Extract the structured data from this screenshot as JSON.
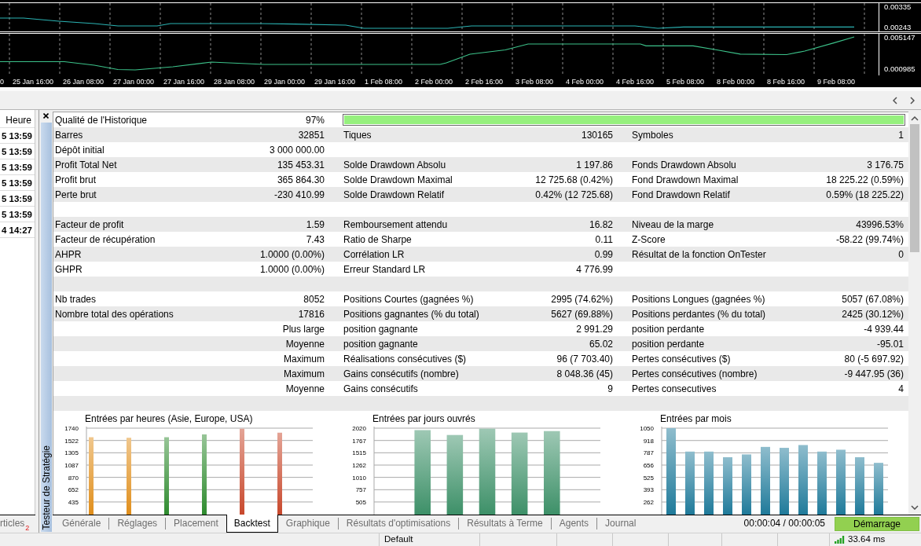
{
  "price_chart": {
    "panels": [
      {
        "axis_labels": [
          "0.00335",
          "0.00243"
        ]
      },
      {
        "axis_labels": [
          "0.005147",
          "0.000985"
        ]
      }
    ],
    "time_labels": [
      "0",
      "25 Jan 16:00",
      "26 Jan 08:00",
      "27 Jan 00:00",
      "27 Jan 16:00",
      "28 Jan 08:00",
      "29 Jan 00:00",
      "29 Jan 16:00",
      "1 Feb 08:00",
      "2 Feb 00:00",
      "2 Feb 16:00",
      "3 Feb 08:00",
      "4 Feb 00:00",
      "4 Feb 16:00",
      "5 Feb 08:00",
      "8 Feb 00:00",
      "8 Feb 16:00",
      "9 Feb 08:00"
    ]
  },
  "left_panel": {
    "column": "Heure",
    "rows": [
      "5 13:59",
      "5 13:59",
      "5 13:59",
      "5 13:59",
      "5 13:59",
      "5 13:59",
      "4 14:27"
    ],
    "tab": {
      "label": "rticles",
      "badge": "2"
    }
  },
  "tester": {
    "title": "Testeur de Stratégie",
    "report": {
      "rows": [
        {
          "kind": "quality",
          "label": "Qualité de l'Historique",
          "value": "97%",
          "level": 1
        },
        {
          "kind": "stats",
          "cells": [
            {
              "label": "Barres",
              "value": "32851"
            },
            {
              "label": "Tiques",
              "value": "130165"
            },
            {
              "label": "Symboles",
              "value": "1"
            }
          ]
        },
        {
          "kind": "stats",
          "cells": [
            {
              "label": "Dépôt initial",
              "value": "3 000 000.00"
            }
          ]
        },
        {
          "kind": "stats",
          "cells": [
            {
              "label": "Profit Total Net",
              "value": "135 453.31"
            },
            {
              "label": "Solde Drawdown Absolu",
              "value": "1 197.86"
            },
            {
              "label": "Fonds Drawdown Absolu",
              "value": "3 176.75"
            }
          ]
        },
        {
          "kind": "stats",
          "cells": [
            {
              "label": "Profit brut",
              "value": "365 864.30"
            },
            {
              "label": "Solde Drawdown Maximal",
              "value": "12 725.68 (0.42%)"
            },
            {
              "label": "Fond Drawdown Maximal",
              "value": "18 225.22 (0.59%)"
            }
          ]
        },
        {
          "kind": "stats",
          "cells": [
            {
              "label": "Perte brut",
              "value": "-230 410.99"
            },
            {
              "label": "Solde Drawdown Relatif",
              "value": "0.42% (12 725.68)"
            },
            {
              "label": "Fond Drawdown Relatif",
              "value": "0.59% (18 225.22)"
            }
          ]
        },
        {
          "kind": "spacer"
        },
        {
          "kind": "stats",
          "cells": [
            {
              "label": "Facteur de profit",
              "value": "1.59"
            },
            {
              "label": "Remboursement attendu",
              "value": "16.82"
            },
            {
              "label": "Niveau de la marge",
              "value": "43996.53%"
            }
          ]
        },
        {
          "kind": "stats",
          "cells": [
            {
              "label": "Facteur de récupération",
              "value": "7.43"
            },
            {
              "label": "Ratio de Sharpe",
              "value": "0.11"
            },
            {
              "label": "Z-Score",
              "value": "-58.22 (99.74%)"
            }
          ]
        },
        {
          "kind": "stats",
          "cells": [
            {
              "label": "AHPR",
              "value": "1.0000 (0.00%)"
            },
            {
              "label": "Corrélation LR",
              "value": "0.99"
            },
            {
              "label": "Résultat de la fonction OnTester",
              "value": "0"
            }
          ]
        },
        {
          "kind": "stats",
          "cells": [
            {
              "label": "GHPR",
              "value": "1.0000 (0.00%)"
            },
            {
              "label": "Erreur Standard LR",
              "value": "4 776.99"
            }
          ]
        },
        {
          "kind": "spacer"
        },
        {
          "kind": "stats",
          "cells": [
            {
              "label": "Nb trades",
              "value": "8052"
            },
            {
              "label": "Positions Courtes (gagnées %)",
              "value": "2995 (74.62%)"
            },
            {
              "label": "Positions Longues (gagnées %)",
              "value": "5057 (67.08%)"
            }
          ]
        },
        {
          "kind": "stats",
          "cells": [
            {
              "label": "Nombre total des opérations",
              "value": "17816"
            },
            {
              "label": "Positions gagnantes (% du total)",
              "value": "5627 (69.88%)"
            },
            {
              "label": "Positions perdantes (% du total)",
              "value": "2425 (30.12%)"
            }
          ]
        },
        {
          "kind": "stats",
          "cells": [
            {
              "value": "Plus large"
            },
            {
              "label": "position gagnante",
              "value": "2 991.29"
            },
            {
              "label": "position perdante",
              "value": "-4 939.44"
            }
          ]
        },
        {
          "kind": "stats",
          "cells": [
            {
              "value": "Moyenne"
            },
            {
              "label": "position gagnante",
              "value": "65.02"
            },
            {
              "label": "position perdante",
              "value": "-95.01"
            }
          ]
        },
        {
          "kind": "stats",
          "cells": [
            {
              "value": "Maximum"
            },
            {
              "label": "Réalisations consécutives ($)",
              "value": "96 (7 703.40)"
            },
            {
              "label": "Pertes consécutives ($)",
              "value": "80 (-5 697.92)"
            }
          ]
        },
        {
          "kind": "stats",
          "cells": [
            {
              "value": "Maximum"
            },
            {
              "label": "Gains consécutifs (nombre)",
              "value": "8 048.36 (45)"
            },
            {
              "label": "Pertes consécutives (nombre)",
              "value": "-9 447.95 (36)"
            }
          ]
        },
        {
          "kind": "stats",
          "cells": [
            {
              "value": "Moyenne"
            },
            {
              "label": "Gains consécutifs",
              "value": "9"
            },
            {
              "label": "Pertes consecutives",
              "value": "4"
            }
          ]
        },
        {
          "kind": "spacer"
        }
      ]
    },
    "charts": [
      {
        "chart_data": {
          "type": "bar",
          "title": "Entrées par heures (Asie, Europe, USA)",
          "ylim": [
            212,
            1740
          ],
          "yticks": [
            435,
            652,
            870,
            1087,
            1305,
            1522,
            1740
          ],
          "grid": true,
          "series": [
            {
              "color": "#e08e1b",
              "values": [
                1580,
                null,
                null,
                null,
                1570,
                null,
                null,
                null,
                null,
                null,
                null,
                null,
                null,
                null,
                null,
                null,
                null,
                null,
                null,
                null,
                null,
                null,
                null,
                null
              ]
            },
            {
              "color": "#2e8b2e",
              "values": [
                null,
                null,
                null,
                null,
                null,
                null,
                null,
                null,
                1580,
                null,
                null,
                null,
                1630,
                null,
                null,
                null,
                null,
                null,
                null,
                null,
                null,
                null,
                null,
                null
              ]
            },
            {
              "color": "#c8482c",
              "values": [
                null,
                null,
                null,
                null,
                null,
                null,
                null,
                null,
                null,
                null,
                null,
                null,
                null,
                null,
                null,
                null,
                1730,
                null,
                null,
                null,
                1660,
                null,
                null,
                null
              ]
            }
          ]
        }
      },
      {
        "chart_data": {
          "type": "bar",
          "title": "Entrées par jours ouvrés",
          "ylim": [
            246,
            2020
          ],
          "yticks": [
            505,
            757,
            1010,
            1262,
            1515,
            1767,
            2020
          ],
          "grid": true,
          "series": [
            {
              "color": "#3d9068",
              "values": [
                null,
                1980,
                1880,
                2010,
                1930,
                1960,
                null
              ]
            }
          ]
        }
      },
      {
        "chart_data": {
          "type": "bar",
          "title": "Entrées par mois",
          "ylim": [
            128,
            1050
          ],
          "yticks": [
            262,
            393,
            525,
            656,
            787,
            918,
            1050
          ],
          "grid": true,
          "series": [
            {
              "color": "#1f7a9a",
              "values": [
                1050,
                800,
                800,
                740,
                770,
                850,
                840,
                870,
                800,
                820,
                740,
                680
              ]
            }
          ]
        }
      }
    ],
    "tabs": [
      {
        "label": "Générale",
        "selected": false
      },
      {
        "label": "Réglages",
        "selected": false
      },
      {
        "label": "Placement",
        "selected": false
      },
      {
        "label": "Backtest",
        "selected": true
      },
      {
        "label": "Graphique",
        "selected": false
      },
      {
        "label": "Résultats d'optimisations",
        "selected": false
      },
      {
        "label": "Résultats à Terme",
        "selected": false
      },
      {
        "label": "Agents",
        "selected": false
      },
      {
        "label": "Journal",
        "selected": false
      }
    ],
    "elapsed": "00:00:04 / 00:00:05",
    "start_button": "Démarrage"
  },
  "status_bar": {
    "profile": "Default",
    "ping": "33.64 ms"
  }
}
